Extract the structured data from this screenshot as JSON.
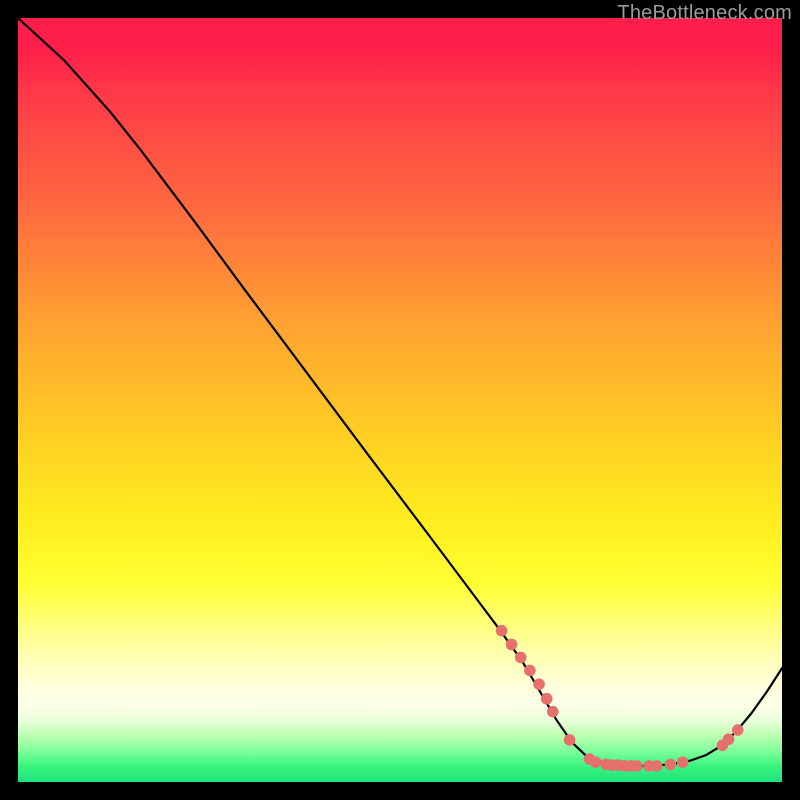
{
  "watermark": "TheBottleneck.com",
  "chart_data": {
    "type": "line",
    "title": "",
    "xlabel": "",
    "ylabel": "",
    "xlim": [
      0,
      100
    ],
    "ylim": [
      0,
      100
    ],
    "grid": false,
    "legend": false,
    "series": [
      {
        "name": "curve",
        "color": "#000000",
        "points": [
          {
            "x": 0,
            "y": 100
          },
          {
            "x": 6,
            "y": 94.5
          },
          {
            "x": 12,
            "y": 87.8
          },
          {
            "x": 16,
            "y": 82.8
          },
          {
            "x": 23,
            "y": 73.5
          },
          {
            "x": 30,
            "y": 64.0
          },
          {
            "x": 38,
            "y": 53.3
          },
          {
            "x": 46,
            "y": 42.6
          },
          {
            "x": 54,
            "y": 32.0
          },
          {
            "x": 60,
            "y": 24.0
          },
          {
            "x": 63,
            "y": 20.0
          },
          {
            "x": 66,
            "y": 15.8
          },
          {
            "x": 68,
            "y": 12.4
          },
          {
            "x": 70.5,
            "y": 8.1
          },
          {
            "x": 72.5,
            "y": 5.2
          },
          {
            "x": 74.5,
            "y": 3.3
          },
          {
            "x": 77,
            "y": 2.4
          },
          {
            "x": 80,
            "y": 2.1
          },
          {
            "x": 83,
            "y": 2.1
          },
          {
            "x": 86,
            "y": 2.4
          },
          {
            "x": 88,
            "y": 2.8
          },
          {
            "x": 90,
            "y": 3.5
          },
          {
            "x": 92,
            "y": 4.7
          },
          {
            "x": 94,
            "y": 6.6
          },
          {
            "x": 96,
            "y": 9.0
          },
          {
            "x": 98,
            "y": 11.8
          },
          {
            "x": 100,
            "y": 14.9
          }
        ]
      }
    ],
    "markers": {
      "name": "dots",
      "color": "#e6706b",
      "radius": 5.8,
      "points": [
        {
          "x": 63.3,
          "y": 19.8
        },
        {
          "x": 64.6,
          "y": 18.0
        },
        {
          "x": 65.8,
          "y": 16.3
        },
        {
          "x": 67.0,
          "y": 14.6
        },
        {
          "x": 68.2,
          "y": 12.8
        },
        {
          "x": 69.2,
          "y": 10.9
        },
        {
          "x": 70.0,
          "y": 9.2
        },
        {
          "x": 72.2,
          "y": 5.5
        },
        {
          "x": 74.8,
          "y": 3.0
        },
        {
          "x": 75.6,
          "y": 2.6
        },
        {
          "x": 77.0,
          "y": 2.3
        },
        {
          "x": 77.8,
          "y": 2.2
        },
        {
          "x": 78.6,
          "y": 2.2
        },
        {
          "x": 79.4,
          "y": 2.1
        },
        {
          "x": 80.2,
          "y": 2.1
        },
        {
          "x": 81.0,
          "y": 2.1
        },
        {
          "x": 82.6,
          "y": 2.1
        },
        {
          "x": 83.6,
          "y": 2.1
        },
        {
          "x": 85.4,
          "y": 2.3
        },
        {
          "x": 87.0,
          "y": 2.6
        },
        {
          "x": 92.2,
          "y": 4.8
        },
        {
          "x": 93.0,
          "y": 5.6
        },
        {
          "x": 94.2,
          "y": 6.8
        }
      ]
    }
  }
}
